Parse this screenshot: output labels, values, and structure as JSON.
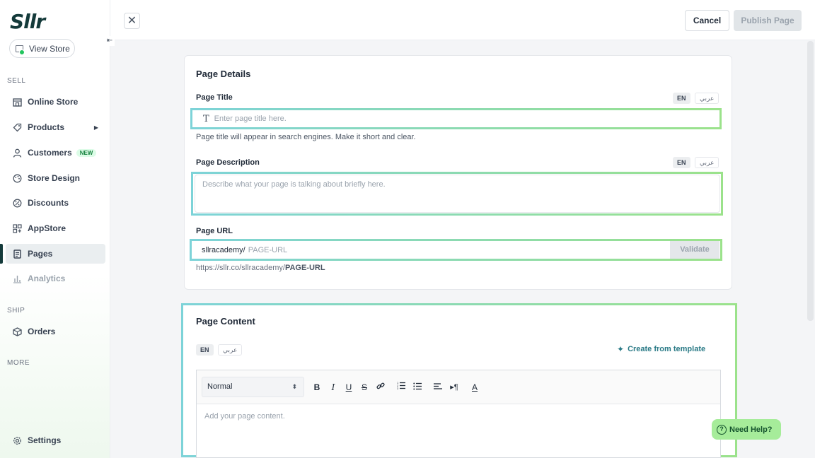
{
  "brand": {
    "logo_text": "Sllr"
  },
  "sidebar": {
    "view_store_label": "View Store",
    "sections": {
      "sell": "SELL",
      "ship": "SHIP",
      "more": "MORE"
    },
    "items": [
      {
        "label": "Online Store",
        "icon": "store-icon"
      },
      {
        "label": "Products",
        "icon": "tag-icon"
      },
      {
        "label": "Customers",
        "icon": "user-icon",
        "badge": "NEW"
      },
      {
        "label": "Store Design",
        "icon": "palette-icon"
      },
      {
        "label": "Discounts",
        "icon": "discount-icon"
      },
      {
        "label": "AppStore",
        "icon": "apps-icon"
      },
      {
        "label": "Pages",
        "icon": "page-icon",
        "active": true
      },
      {
        "label": "Analytics",
        "icon": "chart-icon"
      },
      {
        "label": "Orders",
        "icon": "box-icon"
      },
      {
        "label": "Settings",
        "icon": "gear-icon"
      }
    ]
  },
  "topbar": {
    "cancel_label": "Cancel",
    "publish_label": "Publish Page"
  },
  "details": {
    "heading": "Page Details",
    "lang_en": "EN",
    "lang_ar": "عربي",
    "title_label": "Page Title",
    "title_placeholder": "Enter page title here.",
    "title_help": "Page title will appear in search engines. Make it short and clear.",
    "desc_label": "Page Description",
    "desc_placeholder": "Describe what your page is talking about briefly here.",
    "url_label": "Page URL",
    "url_prefix": "sllracademy/",
    "url_placeholder": "PAGE-URL",
    "validate_label": "Validate",
    "url_preview_base": "https://sllr.co/sllracademy/",
    "url_preview_slug": "PAGE-URL"
  },
  "content": {
    "heading": "Page Content",
    "lang_en": "EN",
    "lang_ar": "عربي",
    "template_link": "Create from template",
    "format_value": "Normal",
    "editor_placeholder": "Add your page content."
  },
  "help_widget": {
    "label": "Need Help?"
  },
  "colors": {
    "brand": "#143a3a",
    "accent": "#2a7a86",
    "help_bg": "#a6ec9a"
  }
}
